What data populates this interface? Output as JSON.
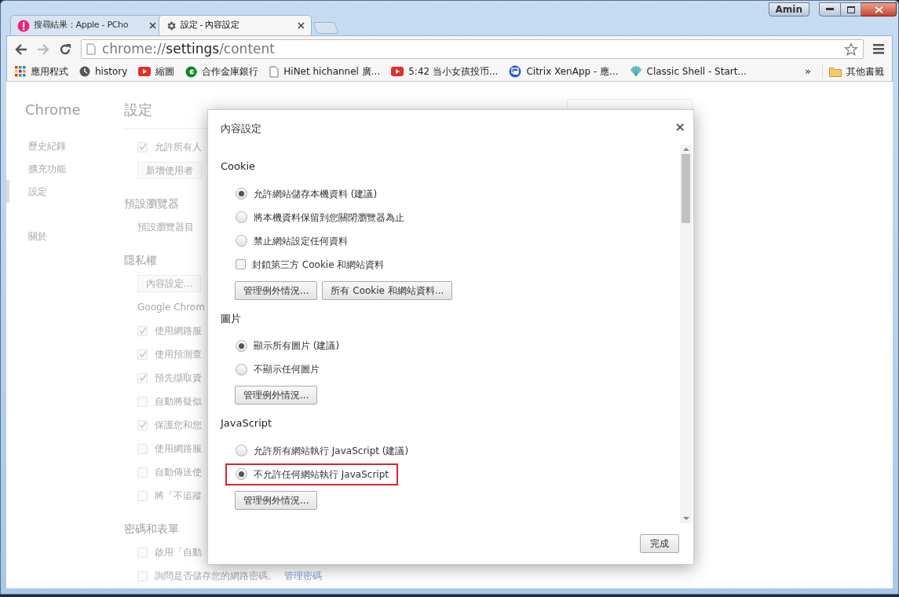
{
  "window": {
    "user": "Amin"
  },
  "tabs": [
    {
      "title": "搜尋結果：Apple - PCho",
      "kind": "site",
      "selected": false
    },
    {
      "title": "設定 - 內容設定",
      "kind": "settings",
      "selected": true
    }
  ],
  "address": {
    "scheme": "chrome://",
    "host": "settings",
    "path": "/content"
  },
  "bookmarks": [
    {
      "label": "應用程式",
      "kind": "apps"
    },
    {
      "label": "history",
      "kind": "clock"
    },
    {
      "label": "縮圖",
      "kind": "video"
    },
    {
      "label": "合作金庫銀行",
      "kind": "bank"
    },
    {
      "label": "HiNet hichannel 廣...",
      "kind": "page"
    },
    {
      "label": "5:42 当小女孩投币...",
      "kind": "video"
    },
    {
      "label": "Citrix XenApp - 應...",
      "kind": "citrix"
    },
    {
      "label": "Classic Shell - Start...",
      "kind": "shell"
    }
  ],
  "bookmarks_more": "»",
  "other_bookmarks": "其他書籤",
  "sidebar": {
    "title": "Chrome",
    "items": [
      {
        "label": "歷史紀錄",
        "selected": false
      },
      {
        "label": "擴充功能",
        "selected": false
      },
      {
        "label": "設定",
        "selected": true
      },
      {
        "label": "關於",
        "selected": false
      }
    ]
  },
  "settings": {
    "title": "設定",
    "rows": [
      {
        "kind": "checkbox",
        "label": "允許所有人",
        "checked": true
      },
      {
        "kind": "button",
        "label": "新增使用者"
      },
      {
        "kind": "heading",
        "label": "預設瀏覽器"
      },
      {
        "kind": "text",
        "label": "預設瀏覽器目"
      },
      {
        "kind": "heading",
        "label": "隱私權"
      },
      {
        "kind": "button",
        "label": "內容設定..."
      },
      {
        "kind": "text",
        "label": "Google Chrom"
      },
      {
        "kind": "checkbox",
        "label": "使用網路服",
        "checked": true
      },
      {
        "kind": "checkbox",
        "label": "使用預測查",
        "checked": true
      },
      {
        "kind": "checkbox",
        "label": "預先擷取資",
        "checked": true
      },
      {
        "kind": "checkbox",
        "label": "自動將疑似",
        "checked": false
      },
      {
        "kind": "checkbox",
        "label": "保護您和您",
        "checked": true
      },
      {
        "kind": "checkbox",
        "label": "使用網路服",
        "checked": false
      },
      {
        "kind": "checkbox",
        "label": "自動傳送使",
        "checked": false
      },
      {
        "kind": "checkbox",
        "label": "將「不追蹤",
        "checked": false
      },
      {
        "kind": "heading",
        "label": "密碼和表單"
      },
      {
        "kind": "checkbox",
        "label": "啟用「自動",
        "checked": false
      },
      {
        "kind": "checkbox",
        "label": "詢問是否儲存您的網路密碼。",
        "checked": false,
        "link": "管理密碼"
      }
    ]
  },
  "dialog": {
    "title": "內容設定",
    "close": "×",
    "done": "完成",
    "sections": [
      {
        "title": "Cookie",
        "items": [
          {
            "kind": "radio",
            "label": "允許網站儲存本機資料 (建議)",
            "selected": true,
            "highlighted": false
          },
          {
            "kind": "radio",
            "label": "將本機資料保留到您關閉瀏覽器為止",
            "selected": false,
            "highlighted": false
          },
          {
            "kind": "radio",
            "label": "禁止網站設定任何資料",
            "selected": false,
            "highlighted": false
          },
          {
            "kind": "checkbox",
            "label": "封鎖第三方 Cookie 和網站資料",
            "checked": false,
            "highlighted": false
          }
        ],
        "buttons": [
          "管理例外情況...",
          "所有 Cookie 和網站資料..."
        ]
      },
      {
        "title": "圖片",
        "items": [
          {
            "kind": "radio",
            "label": "顯示所有圖片 (建議)",
            "selected": true,
            "highlighted": false
          },
          {
            "kind": "radio",
            "label": "不顯示任何圖片",
            "selected": false,
            "highlighted": false
          }
        ],
        "buttons": [
          "管理例外情況..."
        ]
      },
      {
        "title": "JavaScript",
        "items": [
          {
            "kind": "radio",
            "label": "允許所有網站執行 JavaScript (建議)",
            "selected": false,
            "highlighted": false
          },
          {
            "kind": "radio",
            "label": "不允許任何網站執行 JavaScript",
            "selected": true,
            "highlighted": true
          }
        ],
        "buttons": [
          "管理例外情況..."
        ]
      }
    ]
  }
}
